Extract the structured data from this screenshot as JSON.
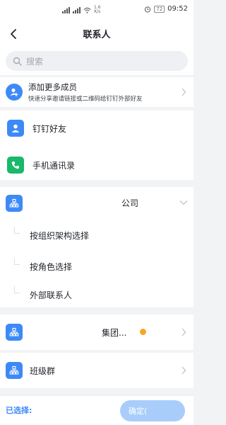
{
  "status_bar": {
    "speed_value": "1.6",
    "speed_unit": "K/s",
    "battery": "72",
    "time": "09:52"
  },
  "nav": {
    "title": "联系人"
  },
  "search": {
    "placeholder": "搜索"
  },
  "add_members": {
    "title": "添加更多成员",
    "subtitle": "快速分享邀请链接或二维码给钉钉外部好友"
  },
  "contacts": [
    {
      "label": "钉钉好友",
      "icon": "person-icon"
    },
    {
      "label": "手机通讯录",
      "icon": "phone-icon"
    }
  ],
  "company": {
    "name": "公司",
    "options": [
      "按组织架构选择",
      "按角色选择",
      "外部联系人"
    ]
  },
  "group": {
    "name": "集团..."
  },
  "class_group": {
    "label": "班级群"
  },
  "footer": {
    "selected_label": "已选择:",
    "confirm_label": "确定("
  },
  "colors": {
    "accent": "#3d8af7",
    "green": "#19b86b",
    "badge": "#f5a623"
  }
}
